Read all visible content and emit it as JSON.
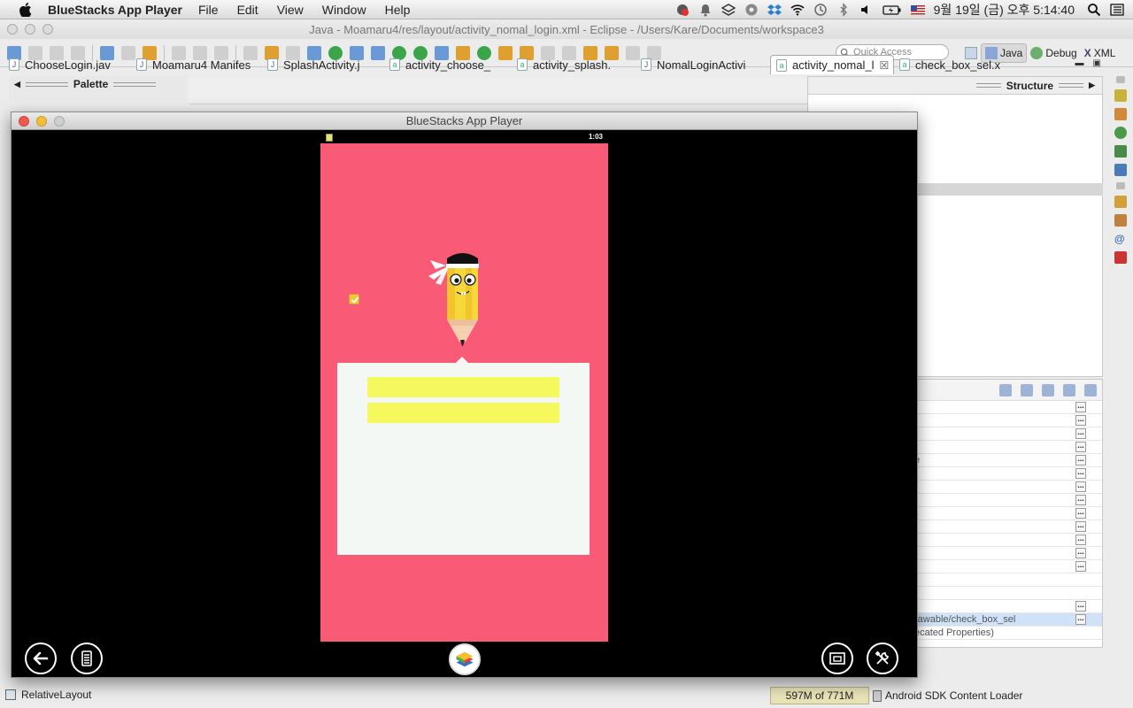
{
  "menubar": {
    "app_name": "BlueStacks App Player",
    "menus": [
      "File",
      "Edit",
      "View",
      "Window",
      "Help"
    ],
    "clock": "9월 19일 (금) 오후  5:14:40"
  },
  "eclipse": {
    "title": "Java - Moamaru4/res/layout/activity_nomal_login.xml - Eclipse - /Users/Kare/Documents/workspace3",
    "quick_access_placeholder": "Quick Access",
    "perspectives": [
      "Java",
      "Debug",
      "XML"
    ],
    "tabs": [
      {
        "label": "ChooseLogin.jav",
        "kind": "java"
      },
      {
        "label": "Moamaru4 Manifes",
        "kind": "java"
      },
      {
        "label": "SplashActivity.j",
        "kind": "java"
      },
      {
        "label": "activity_choose_",
        "kind": "xml"
      },
      {
        "label": "activity_splash.",
        "kind": "xml"
      },
      {
        "label": "NomalLoginActivi",
        "kind": "java"
      },
      {
        "label": "activity_nomal_l",
        "kind": "xml",
        "active": true
      },
      {
        "label": "check_box_sel.x",
        "kind": "xml"
      }
    ],
    "palette_title": "Palette",
    "structure_title": "Structure",
    "properties": {
      "rows_count_note": "",
      "visible_values": [
        "e",
        "rawable/check_box_sel",
        "ecated Properties)"
      ]
    },
    "status": {
      "layout": "RelativeLayout",
      "memory": "597M of 771M",
      "loader": "Android SDK Content Loader"
    }
  },
  "bluestacks": {
    "title": "BlueStacks App Player",
    "phone_time": "1:03",
    "login": {
      "id_value": "",
      "password_value": ""
    },
    "colors": {
      "background": "#f95b77",
      "card": "#f3f8f5",
      "field": "#f5f95d",
      "checkbox": "#f6c53c"
    },
    "icons": [
      "back-icon",
      "menu-icon",
      "bluestacks-logo-icon",
      "window-icon",
      "settings-icon"
    ]
  }
}
